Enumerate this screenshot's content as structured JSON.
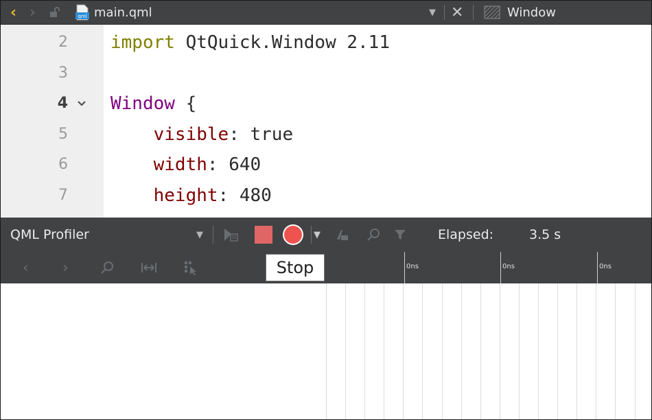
{
  "editor_toolbar": {
    "file_name": "main.qml",
    "window_label": "Window",
    "icons": [
      "back-arrow-icon",
      "forward-arrow-icon",
      "lock-icon",
      "qml-file-icon",
      "dropdown-icon",
      "close-icon",
      "window-hatch-icon"
    ]
  },
  "editor": {
    "lines": [
      {
        "number": "2",
        "parts": [
          {
            "text": "import",
            "kind": "import"
          },
          {
            "text": " QtQuick.Window 2.11",
            "kind": "plain"
          }
        ]
      },
      {
        "number": "3",
        "parts": []
      },
      {
        "number": "4",
        "current": true,
        "foldable": true,
        "parts": [
          {
            "text": "Window",
            "kind": "type"
          },
          {
            "text": " {",
            "kind": "plain"
          }
        ]
      },
      {
        "number": "5",
        "parts": [
          {
            "text": "    visible",
            "kind": "prop"
          },
          {
            "text": ": true",
            "kind": "plain"
          }
        ]
      },
      {
        "number": "6",
        "parts": [
          {
            "text": "    width",
            "kind": "prop"
          },
          {
            "text": ": 640",
            "kind": "plain"
          }
        ]
      },
      {
        "number": "7",
        "parts": [
          {
            "text": "    height",
            "kind": "prop"
          },
          {
            "text": ": 480",
            "kind": "plain"
          }
        ]
      }
    ],
    "colors": {
      "import": "#808000",
      "type": "#800080",
      "prop": "#800000",
      "plain": "#2b2b2b"
    }
  },
  "profiler_toolbar": {
    "title": "QML Profiler",
    "elapsed_label": "Elapsed:",
    "elapsed_value": "3.5 s",
    "stop_color": "#e06666",
    "record_color": "#ef5350"
  },
  "tooltip": {
    "text": "Stop"
  },
  "timeline": {
    "tick_labels": [
      "0ns",
      "0ns",
      "0ns"
    ]
  }
}
